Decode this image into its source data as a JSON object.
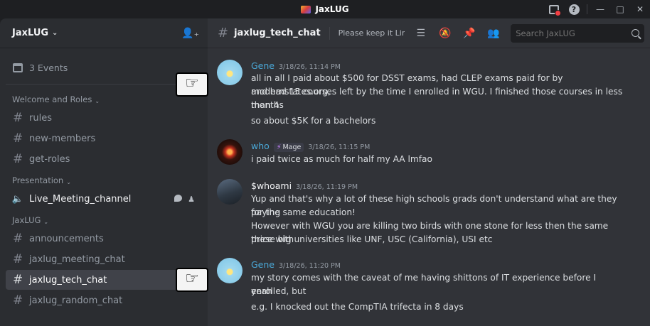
{
  "window": {
    "title": "JaxLUG"
  },
  "sidebar": {
    "server_name": "JaxLUG",
    "events_label": "3 Events",
    "categories": [
      {
        "label": "Welcome and Roles",
        "channels": [
          "rules",
          "new-members",
          "get-roles"
        ]
      },
      {
        "label": "Presentation",
        "voice_channel": "Live_Meeting_channel"
      },
      {
        "label": "JaxLUG",
        "channels": [
          "announcements",
          "jaxlug_meeting_chat",
          "jaxlug_tech_chat",
          "jaxlug_random_chat"
        ]
      }
    ],
    "active_channel": "jaxlug_tech_chat"
  },
  "header": {
    "channel_name": "jaxlug_tech_chat",
    "topic": "Please keep it Lin...",
    "search_placeholder": "Search JaxLUG"
  },
  "messages": [
    {
      "author": "Gene",
      "timestamp": "3/18/26, 11:14 PM",
      "lines": [
        "all in all I paid about $500 for DSST exams, had CLEP exams paid for by modernstates.org,",
        "and had 15 courses left by the time I enrolled in WGU.  I finished those courses in less than 4",
        "months",
        "so about $5K for a bachelors"
      ]
    },
    {
      "author": "who",
      "tag": "Mage",
      "timestamp": "3/18/26, 11:15 PM",
      "lines": [
        "i paid twice as much for half my AA lmfao"
      ]
    },
    {
      "author": "$whoami",
      "timestamp": "3/18/26, 11:19 PM",
      "lines": [
        "Yup and that's why a lot of these high schools grads don't understand what are they paying",
        "for the same education!",
        "However with WGU you are killing two birds with one stone for less then the same price with",
        "these big universities like UNF, USC (California), USI etc"
      ]
    },
    {
      "author": "Gene",
      "timestamp": "3/18/26, 11:20 PM",
      "lines": [
        "my story comes with the caveat of me having shittons of IT experience before I enrolled, but",
        "yeah",
        "e.g. I knocked out the CompTIA trifecta in 8 days"
      ]
    }
  ],
  "colors": {
    "sidebar_bg": "#2b2d31",
    "main_bg": "#313338",
    "author_blue": "#4aa7d6",
    "active_channel_bg": "#404249"
  }
}
